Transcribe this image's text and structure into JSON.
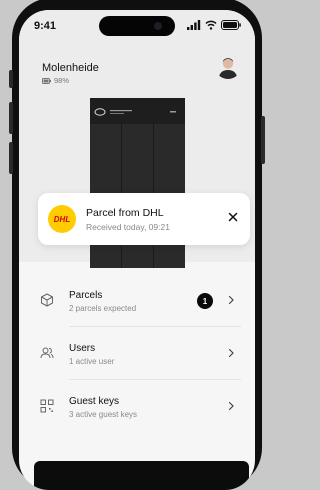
{
  "status_bar": {
    "time": "9:41"
  },
  "header": {
    "location": "Molenheide",
    "battery": "98%"
  },
  "notification": {
    "logo_text": "DHL",
    "title": "Parcel from DHL",
    "subtitle": "Received today, 09:21"
  },
  "list": {
    "items": [
      {
        "title": "Parcels",
        "subtitle": "2 parcels expected",
        "badge": "1",
        "icon": "box-icon"
      },
      {
        "title": "Users",
        "subtitle": "1 active user",
        "icon": "users-icon"
      },
      {
        "title": "Guest keys",
        "subtitle": "3 active guest keys",
        "icon": "qr-icon"
      }
    ]
  },
  "unlock_button": {
    "label": ""
  },
  "colors": {
    "accent": "#0a0a0a",
    "dhl_yellow": "#ffcc00",
    "dhl_red": "#d40511"
  }
}
